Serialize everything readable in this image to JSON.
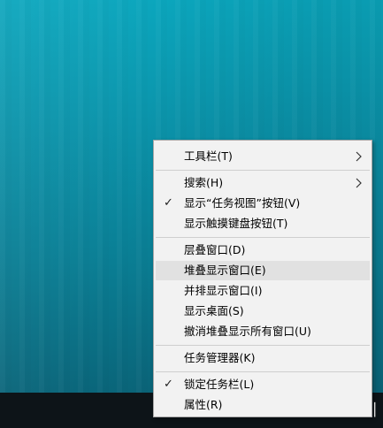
{
  "colors": {
    "desktop_top": "#0ba6bd",
    "desktop_bottom": "#0a5f73",
    "taskbar": "#0d1418",
    "menu_bg": "#f2f2f2",
    "menu_highlight": "#e1e1e1",
    "menu_border": "#a8a8a8"
  },
  "context_menu": {
    "groups": [
      {
        "items": [
          {
            "label": "工具栏(T)",
            "checked": false,
            "submenu": true,
            "highlighted": false
          }
        ]
      },
      {
        "items": [
          {
            "label": "搜索(H)",
            "checked": false,
            "submenu": true,
            "highlighted": false
          },
          {
            "label": "显示“任务视图”按钮(V)",
            "checked": true,
            "submenu": false,
            "highlighted": false
          },
          {
            "label": "显示触摸键盘按钮(T)",
            "checked": false,
            "submenu": false,
            "highlighted": false
          }
        ]
      },
      {
        "items": [
          {
            "label": "层叠窗口(D)",
            "checked": false,
            "submenu": false,
            "highlighted": false
          },
          {
            "label": "堆叠显示窗口(E)",
            "checked": false,
            "submenu": false,
            "highlighted": true
          },
          {
            "label": "并排显示窗口(I)",
            "checked": false,
            "submenu": false,
            "highlighted": false
          },
          {
            "label": "显示桌面(S)",
            "checked": false,
            "submenu": false,
            "highlighted": false
          },
          {
            "label": "撤消堆叠显示所有窗口(U)",
            "checked": false,
            "submenu": false,
            "highlighted": false
          }
        ]
      },
      {
        "items": [
          {
            "label": "任务管理器(K)",
            "checked": false,
            "submenu": false,
            "highlighted": false
          }
        ]
      },
      {
        "items": [
          {
            "label": "锁定任务栏(L)",
            "checked": true,
            "submenu": false,
            "highlighted": false
          },
          {
            "label": "属性(R)",
            "checked": false,
            "submenu": false,
            "highlighted": false
          }
        ]
      }
    ],
    "check_glyph": "✓"
  },
  "taskbar": {
    "tray_glyph": "▏"
  }
}
